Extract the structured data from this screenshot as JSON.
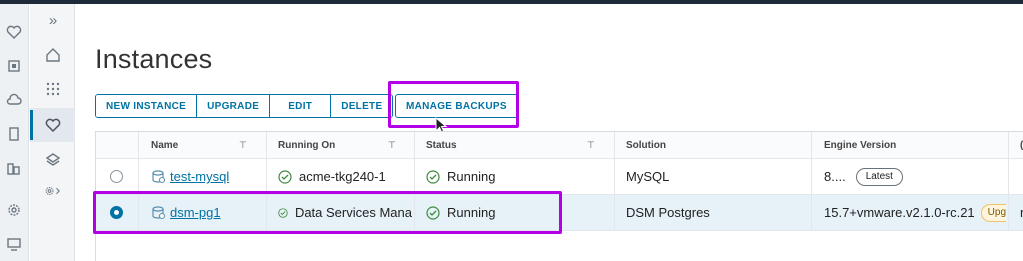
{
  "app": {
    "page_title": "Instances",
    "expand_glyph": "»"
  },
  "rail_icons": [
    "heart-shield-icon",
    "chip-icon",
    "cloud-icon",
    "document-icon",
    "buildings-icon",
    "gear-icon",
    "monitor-icon"
  ],
  "subnav_icons": [
    "expand-icon",
    "home-icon",
    "apps-grid-icon",
    "instances-icon",
    "stack-icon",
    "settings-icon"
  ],
  "toolbar": {
    "new_instance": "NEW INSTANCE",
    "upgrade": "UPGRADE",
    "edit": "EDIT",
    "delete": "DELETE",
    "manage_backups": "MANAGE BACKUPS"
  },
  "table": {
    "columns": [
      "Name",
      "Running On",
      "Status",
      "Solution",
      "Engine Version",
      "("
    ],
    "rows": [
      {
        "name": "test-mysql",
        "running_on": "acme-tkg240-1",
        "status": "Running",
        "solution": "MySQL",
        "engine_version": "8....",
        "badge": "Latest",
        "selected": false,
        "extra": ""
      },
      {
        "name": "dsm-pg1",
        "running_on": "Data Services Mana",
        "status": "Running",
        "solution": "DSM Postgres",
        "engine_version": "15.7+vmware.v2.1.0-rc.21",
        "badge": "Upgrac",
        "selected": true,
        "extra": "r"
      }
    ]
  },
  "colors": {
    "accent": "#0072a3",
    "highlight": "#b400e6",
    "selected_row": "#e6f1f8"
  }
}
